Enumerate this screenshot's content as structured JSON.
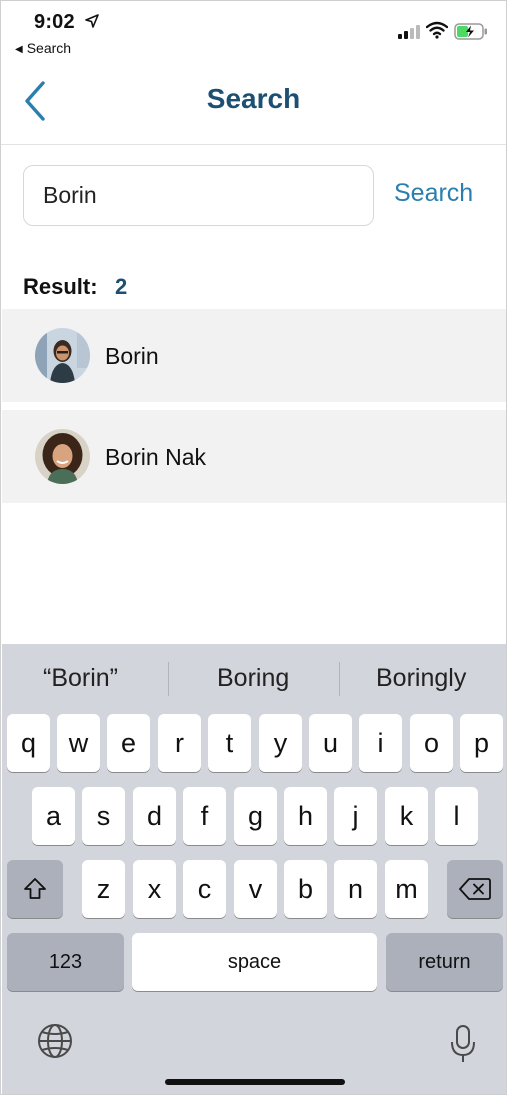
{
  "status_bar": {
    "time": "9:02",
    "back_app_label": "Search"
  },
  "nav": {
    "title": "Search",
    "title_color": "#1d4f72"
  },
  "search": {
    "value": "Borin",
    "button_label": "Search",
    "button_color": "#2b7fae"
  },
  "result": {
    "label": "Result:",
    "count": "2"
  },
  "results": [
    {
      "name": "Borin",
      "avatar": "avatar-photo"
    },
    {
      "name": "Borin Nak",
      "avatar": "avatar-photo"
    }
  ],
  "keyboard": {
    "suggestions": [
      "“Borin”",
      "Boring",
      "Boringly"
    ],
    "row1": [
      "q",
      "w",
      "e",
      "r",
      "t",
      "y",
      "u",
      "i",
      "o",
      "p"
    ],
    "row2": [
      "a",
      "s",
      "d",
      "f",
      "g",
      "h",
      "j",
      "k",
      "l"
    ],
    "row3": [
      "z",
      "x",
      "c",
      "v",
      "b",
      "n",
      "m"
    ],
    "numbers_label": "123",
    "space_label": "space",
    "return_label": "return",
    "shift_icon": "shift-icon",
    "delete_icon": "backspace-icon",
    "globe_icon": "globe-icon",
    "mic_icon": "microphone-icon"
  }
}
